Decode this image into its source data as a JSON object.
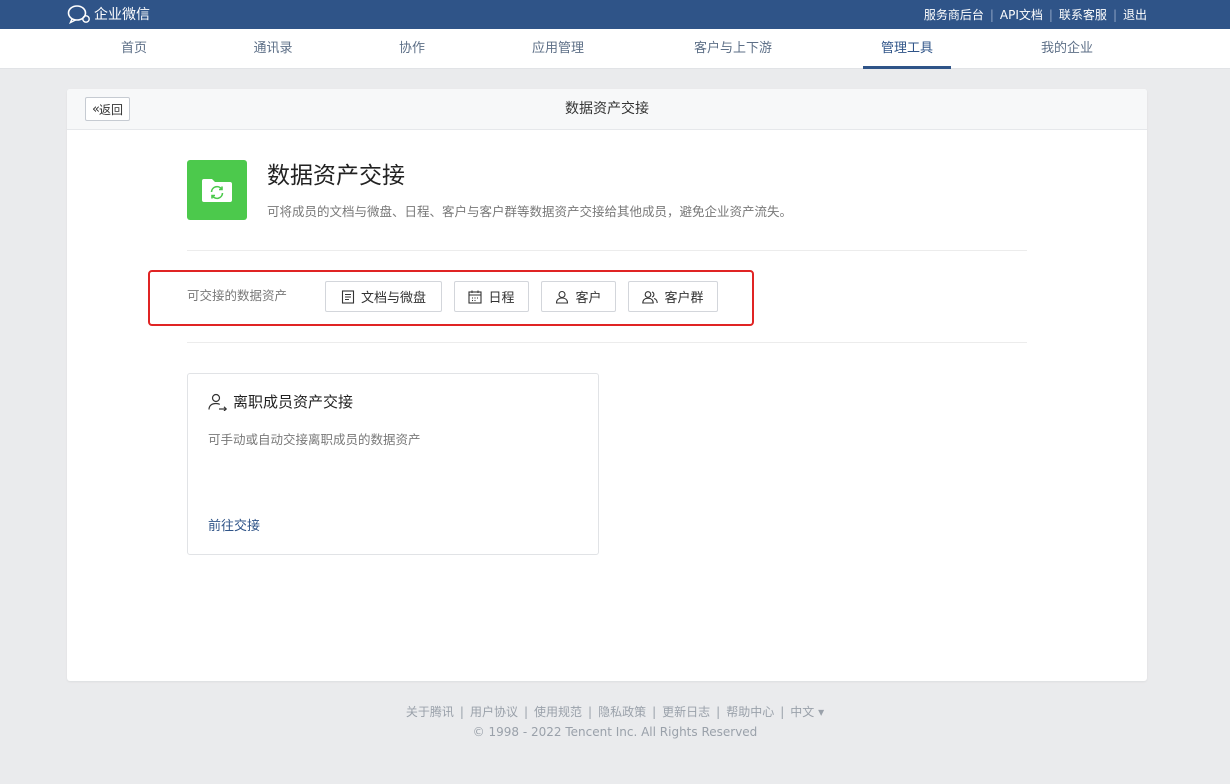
{
  "topbar": {
    "logo_text": "企业微信",
    "links": [
      "服务商后台",
      "API文档",
      "联系客服",
      "退出"
    ]
  },
  "nav": {
    "items": [
      "首页",
      "通讯录",
      "协作",
      "应用管理",
      "客户与上下游",
      "管理工具",
      "我的企业"
    ],
    "active": "管理工具"
  },
  "page": {
    "back_label": "返回",
    "header_title": "数据资产交接",
    "feature_title": "数据资产交接",
    "feature_desc": "可将成员的文档与微盘、日程、客户与客户群等数据资产交接给其他成员，避免企业资产流失。",
    "assets_label": "可交接的数据资产",
    "asset_buttons": [
      {
        "label": "文档与微盘",
        "icon": "document-icon"
      },
      {
        "label": "日程",
        "icon": "calendar-icon"
      },
      {
        "label": "客户",
        "icon": "person-icon"
      },
      {
        "label": "客户群",
        "icon": "group-icon"
      }
    ],
    "highlight_color": "#e02424",
    "sub_card": {
      "title": "离职成员资产交接",
      "desc": "可手动或自动交接离职成员的数据资产",
      "link": "前往交接"
    }
  },
  "footer": {
    "links": [
      "关于腾讯",
      "用户协议",
      "使用规范",
      "隐私政策",
      "更新日志",
      "帮助中心",
      "中文 ▾"
    ],
    "copyright": "© 1998 - 2022 Tencent Inc. All Rights Reserved"
  },
  "colors": {
    "topbar": "#2f5488",
    "accent": "#2f5488",
    "feature_icon_bg": "#4cc94c"
  }
}
